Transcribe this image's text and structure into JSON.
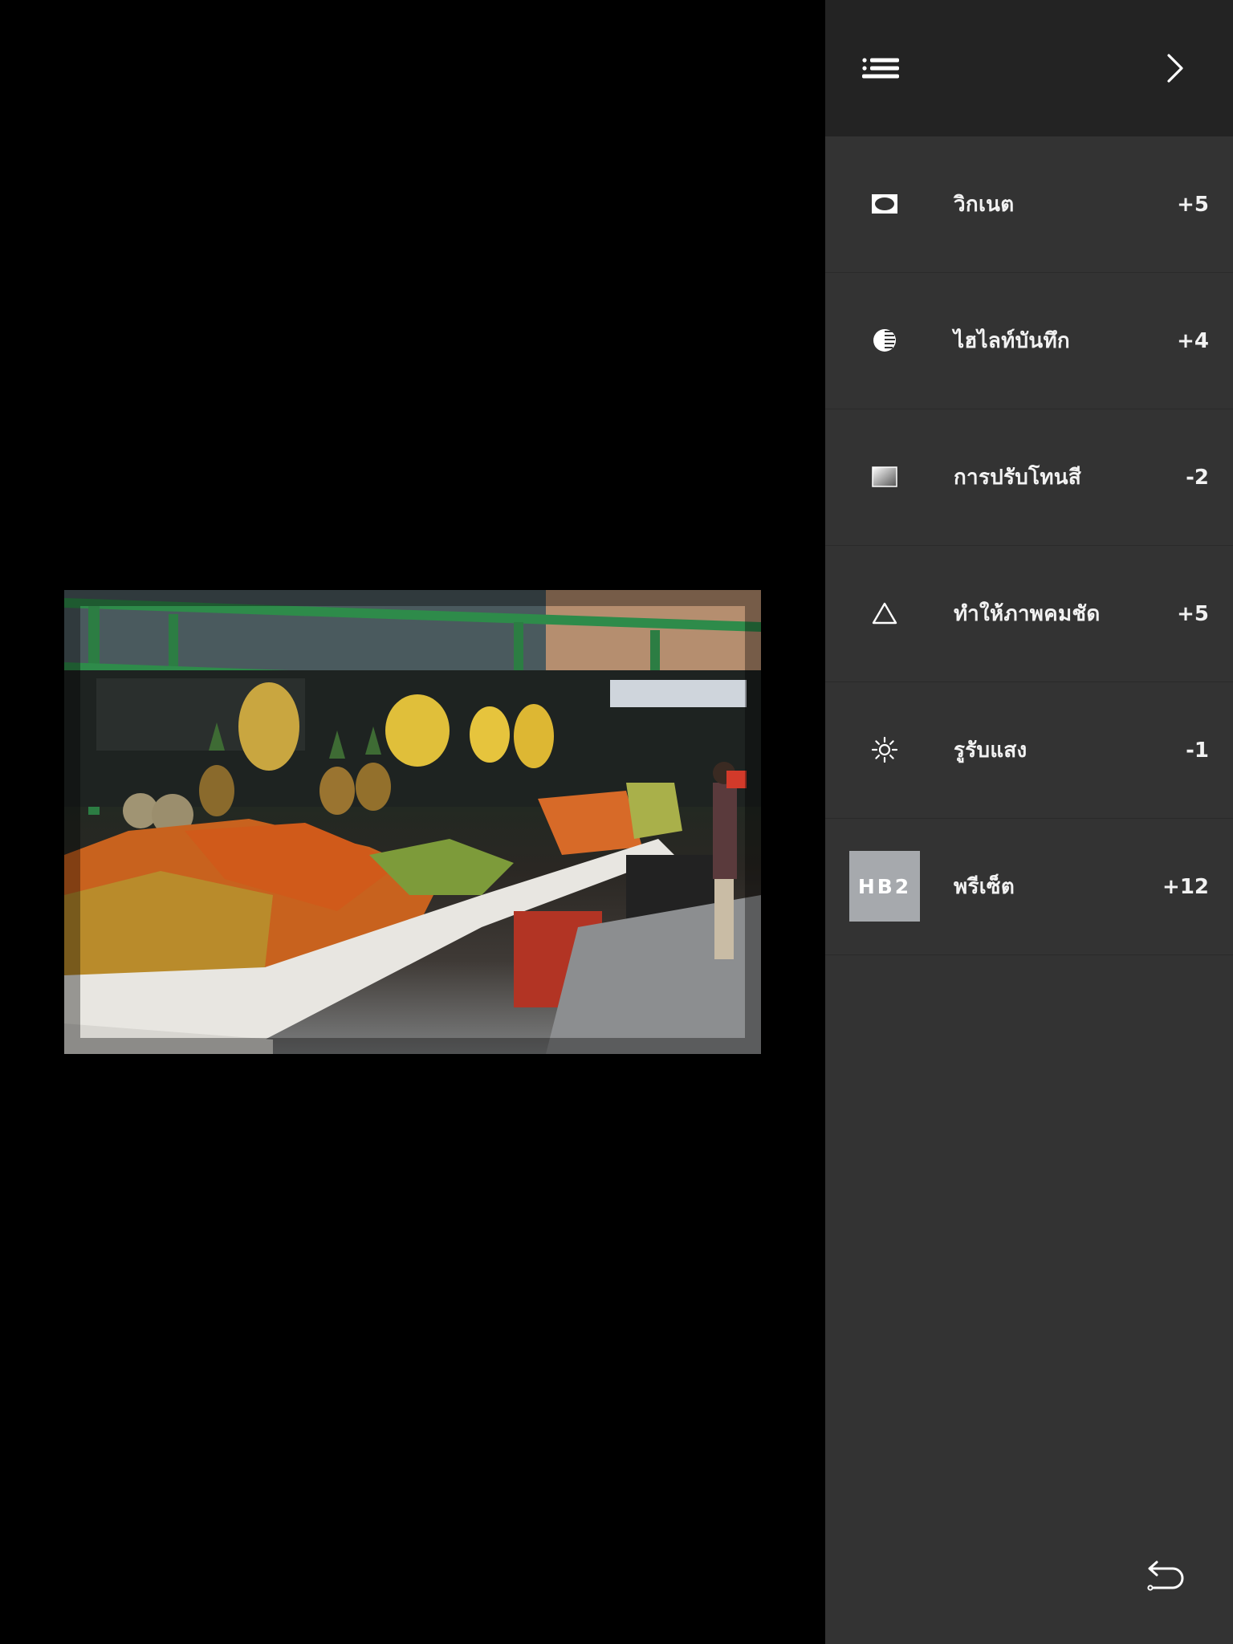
{
  "canvas": {
    "photo_alt": "Market stall with fruit"
  },
  "panel": {
    "header": {
      "list_icon": "list-icon",
      "next_icon": "chevron-right-icon"
    },
    "tools": [
      {
        "icon": "vignette-icon",
        "label": "วิกเนต",
        "value": "+5"
      },
      {
        "icon": "highlights-icon",
        "label": "ไฮไลท์บันทึก",
        "value": "+4"
      },
      {
        "icon": "tone-icon",
        "label": "การปรับโทนสี",
        "value": "-2"
      },
      {
        "icon": "sharpen-icon",
        "label": "ทำให้ภาพคมชัด",
        "value": "+5"
      },
      {
        "icon": "exposure-icon",
        "label": "รูรับแสง",
        "value": "-1"
      },
      {
        "icon": "preset-badge",
        "label": "พรีเซ็ต",
        "value": "+12",
        "badge": "HB2"
      }
    ],
    "undo_icon": "undo-icon"
  },
  "colors": {
    "panel_bg": "#333333",
    "header_bg": "#232323",
    "text": "#f2f2f2",
    "preset_badge": "#a6a9ad"
  }
}
